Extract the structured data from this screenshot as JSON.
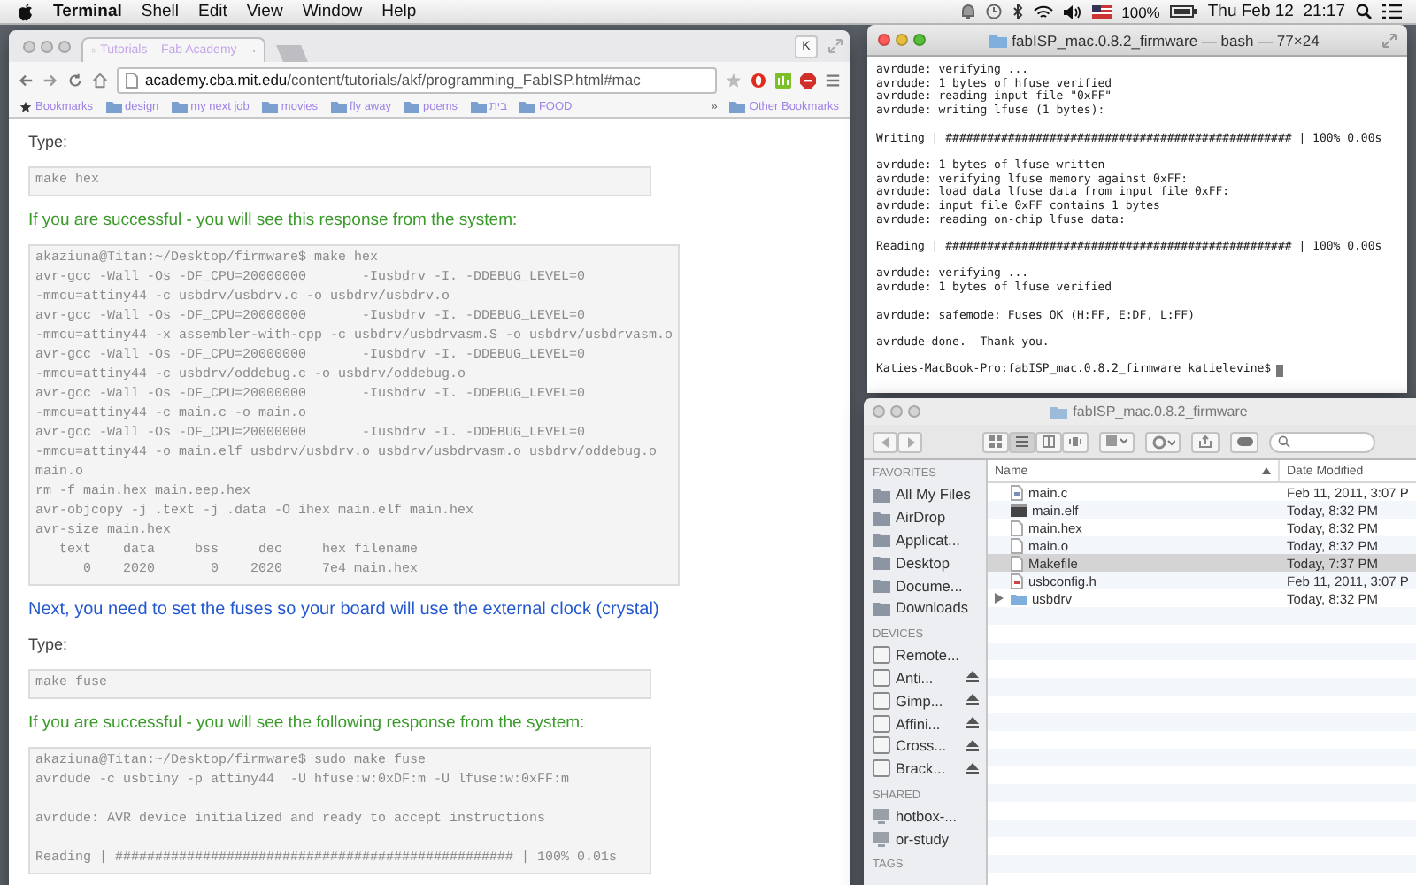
{
  "menu_bar": {
    "app": "Terminal",
    "items": [
      "Shell",
      "Edit",
      "View",
      "Window",
      "Help"
    ],
    "battery": "100%",
    "clock": "Thu Feb 12  21:17"
  },
  "browser": {
    "tab": {
      "title": "Tutorials – Fab Academy –",
      "selected": true
    },
    "url": {
      "host": "academy.cba.mit.edu",
      "path": "/content/tutorials/akf/programming_FabISP.html#mac"
    },
    "profile": "K",
    "bookmarks": [
      "design",
      "my next job",
      "movies",
      "fly away",
      "poems",
      "בית",
      "FOOD"
    ],
    "bookmarks_label": "Bookmarks",
    "overflow": "»",
    "other_bookmarks": "Other Bookmarks",
    "content": [
      {
        "kind": "label",
        "text": "Type:"
      },
      {
        "kind": "command",
        "blocks": [
          [
            "make hex"
          ]
        ]
      },
      {
        "kind": "success",
        "text": "If you are successful - you will see this response from the system:"
      },
      {
        "kind": "output",
        "blocks": [
          [
            "akaziuna@Titan:~/Desktop/firmware$ make hex",
            "avr-gcc -Wall -Os -DF_CPU=20000000       -Iusbdrv -I. -DDEBUG_LEVEL=0",
            "-mmcu=attiny44 -c usbdrv/usbdrv.c -o usbdrv/usbdrv.o",
            "avr-gcc -Wall -Os -DF_CPU=20000000       -Iusbdrv -I. -DDEBUG_LEVEL=0",
            "-mmcu=attiny44 -x assembler-with-cpp -c usbdrv/usbdrvasm.S -o usbdrv/usbdrvasm.o",
            "avr-gcc -Wall -Os -DF_CPU=20000000       -Iusbdrv -I. -DDEBUG_LEVEL=0",
            "-mmcu=attiny44 -c usbdrv/oddebug.c -o usbdrv/oddebug.o",
            "avr-gcc -Wall -Os -DF_CPU=20000000       -Iusbdrv -I. -DDEBUG_LEVEL=0",
            "-mmcu=attiny44 -c main.c -o main.o",
            "avr-gcc -Wall -Os -DF_CPU=20000000       -Iusbdrv -I. -DDEBUG_LEVEL=0",
            "-mmcu=attiny44 -o main.elf usbdrv/usbdrv.o usbdrv/usbdrvasm.o usbdrv/oddebug.o",
            "main.o",
            "rm -f main.hex main.eep.hex",
            "avr-objcopy -j .text -j .data -O ihex main.elf main.hex",
            "avr-size main.hex",
            "   text    data     bss     dec     hex filename",
            "      0    2020       0    2020     7e4 main.hex"
          ]
        ]
      },
      {
        "kind": "note",
        "text": "Next, you need to set the fuses so your board will use the external clock (crystal)"
      },
      {
        "kind": "label",
        "text": "Type:"
      },
      {
        "kind": "command",
        "blocks": [
          [
            "make fuse"
          ]
        ]
      },
      {
        "kind": "success",
        "text": "If you are successful - you will see the following response from the system:"
      },
      {
        "kind": "output",
        "blocks": [
          [
            "akaziuna@Titan:~/Desktop/firmware$ sudo make fuse",
            "avrdude -c usbtiny -p attiny44  -U hfuse:w:0xDF:m -U lfuse:w:0xFF:m"
          ],
          [
            "avrdude: AVR device initialized and ready to accept instructions"
          ],
          [
            "Reading | ################################################## | 100% 0.01s"
          ]
        ]
      }
    ]
  },
  "terminal": {
    "title": "fabISP_mac.0.8.2_firmware — bash — 77×24",
    "blocks": [
      [
        "avrdude: verifying ...",
        "avrdude: 1 bytes of hfuse verified",
        "avrdude: reading input file \"0xFF\"",
        "avrdude: writing lfuse (1 bytes):"
      ],
      [
        "Writing | ################################################## | 100% 0.00s"
      ],
      [
        "avrdude: 1 bytes of lfuse written",
        "avrdude: verifying lfuse memory against 0xFF:",
        "avrdude: load data lfuse data from input file 0xFF:",
        "avrdude: input file 0xFF contains 1 bytes",
        "avrdude: reading on-chip lfuse data:"
      ],
      [
        "Reading | ################################################## | 100% 0.00s"
      ],
      [
        "avrdude: verifying ...",
        "avrdude: 1 bytes of lfuse verified"
      ],
      [
        "avrdude: safemode: Fuses OK (H:FF, E:DF, L:FF)"
      ],
      [
        "avrdude done.  Thank you."
      ]
    ],
    "prompt": "Katies-MacBook-Pro:fabISP_mac.0.8.2_firmware katielevine$"
  },
  "finder": {
    "title": "fabISP_mac.0.8.2_firmware",
    "sidebar": [
      {
        "heading": "FAVORITES",
        "kind": "places",
        "items": [
          {
            "label": "All My Files",
            "ejectable": false
          },
          {
            "label": "AirDrop",
            "ejectable": false
          },
          {
            "label": "Applicat...",
            "ejectable": false
          },
          {
            "label": "Desktop",
            "ejectable": false
          },
          {
            "label": "Docume...",
            "ejectable": false
          },
          {
            "label": "Downloads",
            "ejectable": false
          }
        ]
      },
      {
        "heading": "DEVICES",
        "kind": "drives",
        "items": [
          {
            "label": "Remote...",
            "ejectable": false
          },
          {
            "label": "Anti...",
            "ejectable": true
          },
          {
            "label": "Gimp...",
            "ejectable": true
          },
          {
            "label": "Affini...",
            "ejectable": true
          },
          {
            "label": "Cross...",
            "ejectable": true
          },
          {
            "label": "Brack...",
            "ejectable": true
          }
        ]
      },
      {
        "heading": "SHARED",
        "kind": "servers",
        "items": [
          {
            "label": "hotbox-...",
            "ejectable": false
          },
          {
            "label": "or-study",
            "ejectable": false
          }
        ]
      },
      {
        "heading": "TAGS"
      }
    ],
    "columns": [
      "Name",
      "Date Modified"
    ],
    "rows": [
      {
        "name": "main.c",
        "date": "Feb 11, 2011, 3:07 P",
        "kind": "source",
        "selected": false
      },
      {
        "name": "main.elf",
        "date": "Today, 8:32 PM",
        "kind": "binary",
        "selected": false
      },
      {
        "name": "main.hex",
        "date": "Today, 8:32 PM",
        "kind": "document",
        "selected": false
      },
      {
        "name": "main.o",
        "date": "Today, 8:32 PM",
        "kind": "document",
        "selected": false
      },
      {
        "name": "Makefile",
        "date": "Today, 7:37 PM",
        "kind": "document",
        "selected": true
      },
      {
        "name": "usbconfig.h",
        "date": "Feb 11, 2011, 3:07 P",
        "kind": "header",
        "selected": false
      },
      {
        "name": "usbdrv",
        "date": "Today, 8:32 PM",
        "kind": "folder",
        "selected": false
      }
    ]
  }
}
